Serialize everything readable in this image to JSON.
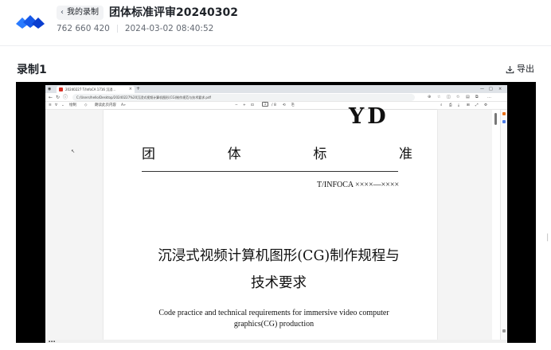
{
  "header": {
    "back_label": "我的录制",
    "title": "团体标准评审20240302",
    "meeting_id": "762 660 420",
    "datetime": "2024-03-02 08:40:52"
  },
  "section": {
    "title": "录制1",
    "export_label": "导出"
  },
  "browser": {
    "tab_title": "20240227 T/InfoCA 1716 沉浸...",
    "url": "C:/Users/hello/Desktop/20240227%20沉浸式视频计算机图形(CG)制作规范与技术要求.pdf",
    "page_number": "1",
    "page_total": "/ 8",
    "read_aloud": "朗读此页内容",
    "draw_label": "绘制"
  },
  "document": {
    "badge": "YD",
    "std_title_chars": [
      "团",
      "体",
      "标",
      "准"
    ],
    "std_code": "T/INFOCA ××××—××××",
    "cn_title_line1": "沉浸式视频计算机图形(CG)制作规程与",
    "cn_title_line2": "技术要求",
    "en_title_line1": "Code practice and technical requirements for immersive video computer",
    "en_title_line2": "graphics(CG) production"
  },
  "colors": {
    "logo_blue": "#1f6bff",
    "logo_dark": "#0a3ecf",
    "accent_red": "#d93025"
  }
}
